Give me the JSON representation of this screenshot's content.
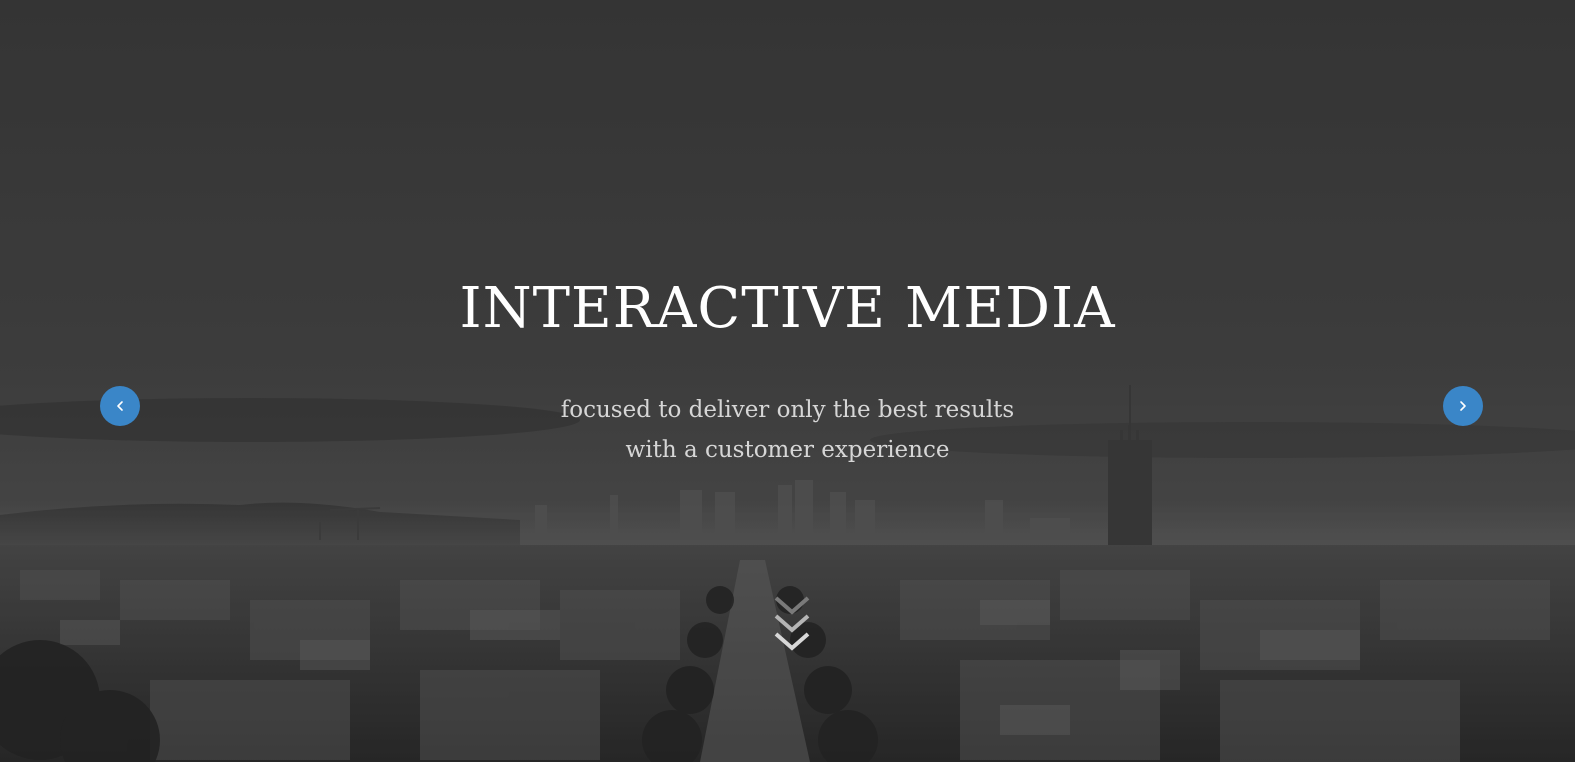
{
  "hero": {
    "title": "INTERACTIVE MEDIA",
    "subtitle_line1": "focused to deliver only the best results",
    "subtitle_line2": "with a customer experience"
  },
  "carousel": {
    "prev_icon": "chevron-left-icon",
    "next_icon": "chevron-right-icon",
    "accent_color": "#3a86c8"
  },
  "scroll": {
    "icon": "double-chevron-down-icon"
  }
}
